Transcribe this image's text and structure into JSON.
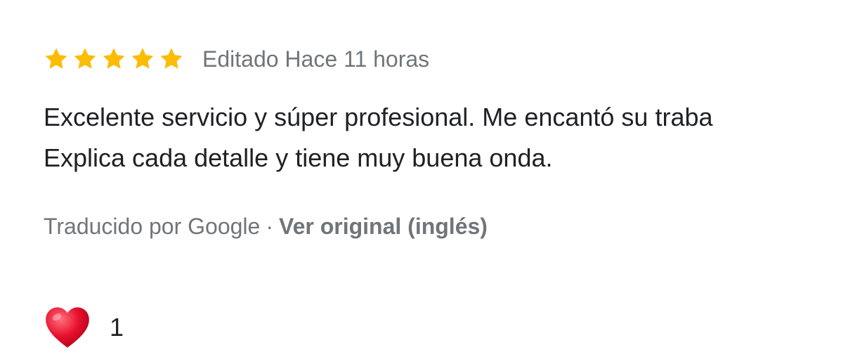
{
  "review": {
    "rating": 5,
    "rating_max": 5,
    "star_color": "#fbbc04",
    "meta": "Editado Hace 11 horas",
    "text_lines": [
      "Excelente servicio y súper profesional. Me encantó su traba",
      "Explica cada detalle y tiene muy buena onda."
    ],
    "translation": {
      "label": "Traducido por Google",
      "separator": "·",
      "link": "Ver original (inglés)"
    },
    "reaction": {
      "icon": "heart-icon",
      "color": "#e0245e",
      "count": "1"
    }
  }
}
